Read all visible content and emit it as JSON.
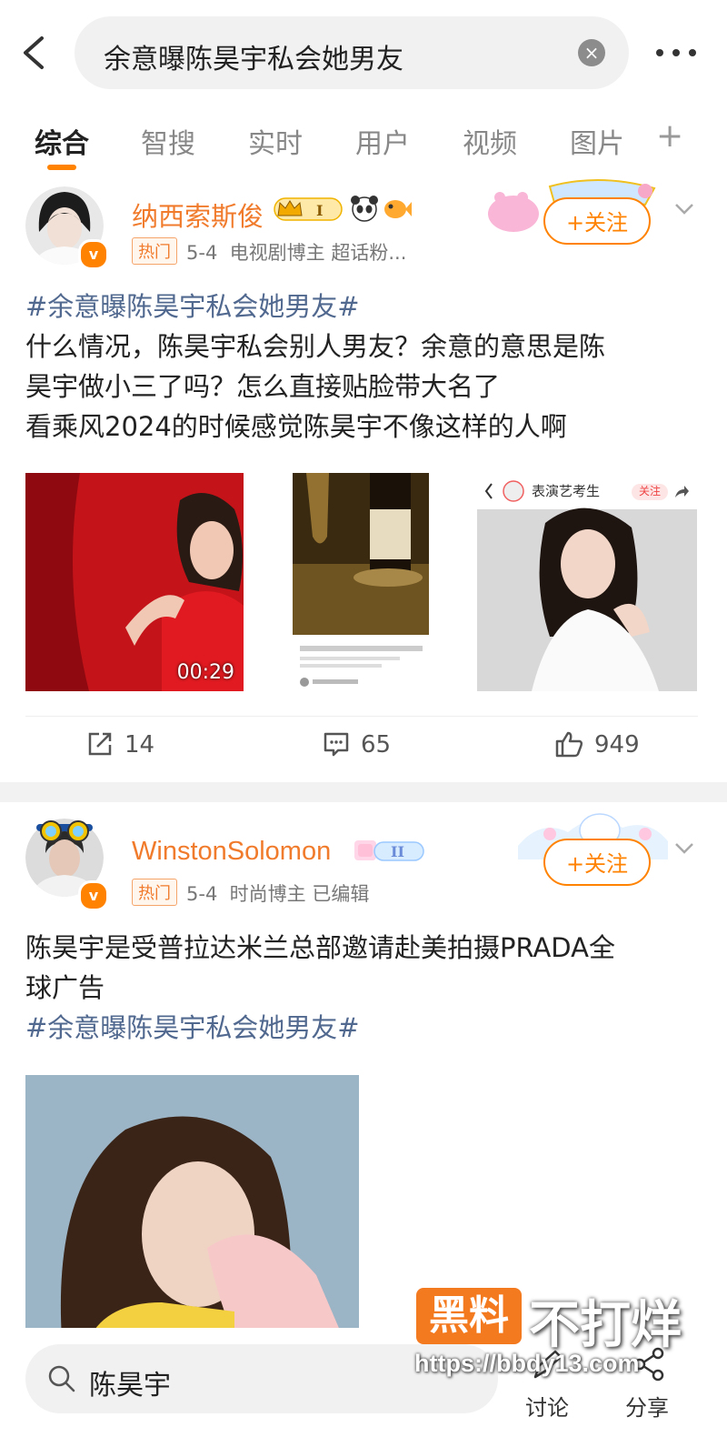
{
  "search": {
    "query": "余意曝陈昊宇私会她男友",
    "clear_icon": "close-icon"
  },
  "tabs": {
    "items": [
      "综合",
      "智搜",
      "实时",
      "用户",
      "视频",
      "图片"
    ],
    "active": "综合",
    "plus": "+"
  },
  "posts": [
    {
      "username": "纳西索斯俊",
      "level_badge": "I",
      "hot_label": "热门",
      "date": "5-4",
      "meta": "电视剧博主 超话粉...",
      "follow_label": "+关注",
      "hashtag": "#余意曝陈昊宇私会她男友#",
      "text_lines": [
        "什么情况，陈昊宇私会别人男友？余意的意思是陈",
        "昊宇做小三了吗？怎么直接贴脸带大名了",
        "看乘风2024的时候感觉陈昊宇不像这样的人啊"
      ],
      "video_duration": "00:29",
      "thumb3_header": "表演艺考生",
      "thumb3_follow": "关注",
      "reposts": "14",
      "comments": "65",
      "likes": "949"
    },
    {
      "username": "WinstonSolomon",
      "level_badge": "II",
      "hot_label": "热门",
      "date": "5-4",
      "meta": "时尚博主 已编辑",
      "follow_label": "+关注",
      "text_lines": [
        "陈昊宇是受普拉达米兰总部邀请赴美拍摄PRADA全",
        "球广告"
      ],
      "hashtag": "#余意曝陈昊宇私会她男友#"
    }
  ],
  "bottom": {
    "search_text": "陈昊宇",
    "discuss_label": "讨论",
    "share_label": "分享"
  },
  "watermark": {
    "brand": "黑料",
    "slogan": "不打烊",
    "url": "https://bbdy13.com"
  },
  "colors": {
    "accent": "#ff8200",
    "username": "#f17b2c",
    "hashtag": "#51688f"
  }
}
